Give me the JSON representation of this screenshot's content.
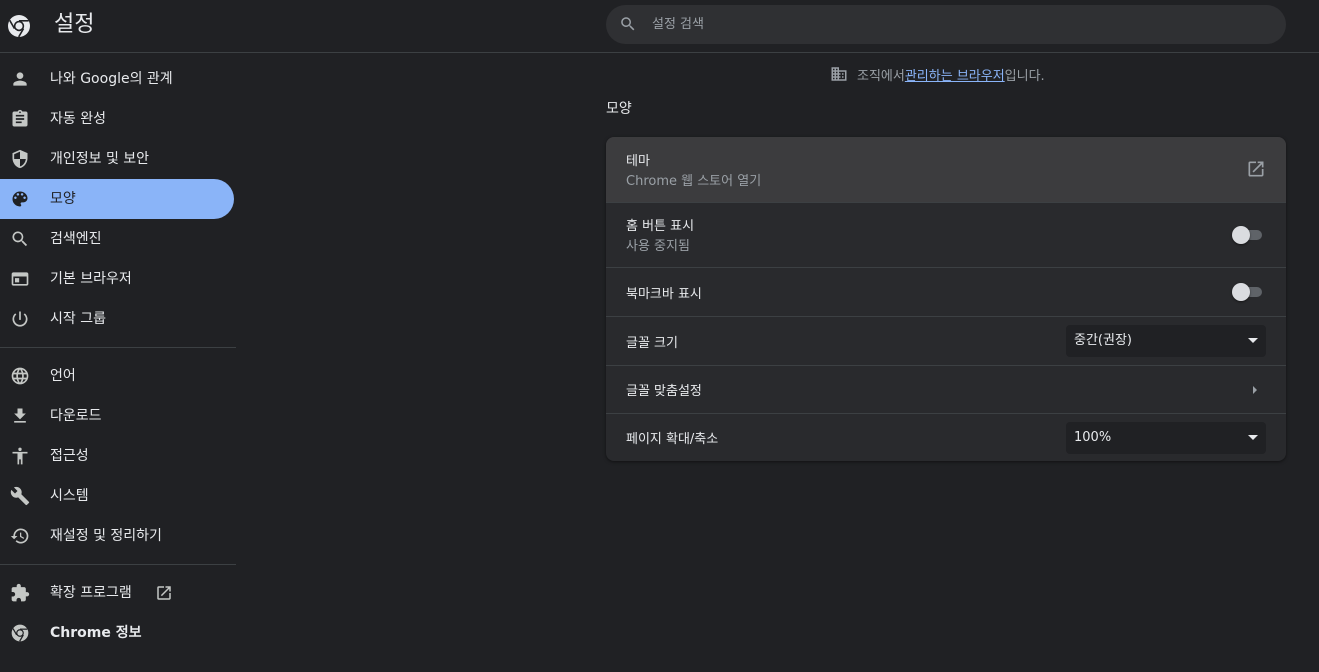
{
  "header": {
    "title": "설정",
    "search_placeholder": "설정 검색"
  },
  "sidebar": {
    "items": [
      {
        "label": "나와 Google의 관계",
        "icon": "person-icon",
        "active": false
      },
      {
        "label": "자동 완성",
        "icon": "clipboard-icon",
        "active": false
      },
      {
        "label": "개인정보 및 보안",
        "icon": "shield-icon",
        "active": false
      },
      {
        "label": "모양",
        "icon": "palette-icon",
        "active": true
      },
      {
        "label": "검색엔진",
        "icon": "search-icon",
        "active": false
      },
      {
        "label": "기본 브라우저",
        "icon": "browser-icon",
        "active": false
      },
      {
        "label": "시작 그룹",
        "icon": "power-icon",
        "active": false
      },
      {
        "label": "언어",
        "icon": "globe-icon",
        "active": false
      },
      {
        "label": "다운로드",
        "icon": "download-icon",
        "active": false
      },
      {
        "label": "접근성",
        "icon": "accessibility-icon",
        "active": false
      },
      {
        "label": "시스템",
        "icon": "wrench-icon",
        "active": false
      },
      {
        "label": "재설정 및 정리하기",
        "icon": "restore-icon",
        "active": false
      },
      {
        "label": "확장 프로그램",
        "icon": "puzzle-icon",
        "active": false
      },
      {
        "label": "Chrome 정보",
        "icon": "chrome-icon",
        "active": false
      }
    ]
  },
  "managed": {
    "prefix": "조직에서 ",
    "link": "관리하는 브라우저",
    "suffix": "입니다."
  },
  "section": {
    "title": "모양"
  },
  "settings": {
    "theme": {
      "title": "테마",
      "subtitle": "Chrome 웹 스토어 열기"
    },
    "home_button": {
      "title": "홈 버튼 표시",
      "subtitle": "사용 중지됨",
      "enabled": false
    },
    "bookmarks_bar": {
      "title": "북마크바 표시",
      "enabled": false
    },
    "font_size": {
      "title": "글꼴 크기",
      "value": "중간(권장)"
    },
    "customize_fonts": {
      "title": "글꼴 맞춤설정"
    },
    "page_zoom": {
      "title": "페이지 확대/축소",
      "value": "100%"
    }
  },
  "colors": {
    "accent": "#8ab4f8",
    "background": "#202124",
    "card": "#292a2d"
  }
}
